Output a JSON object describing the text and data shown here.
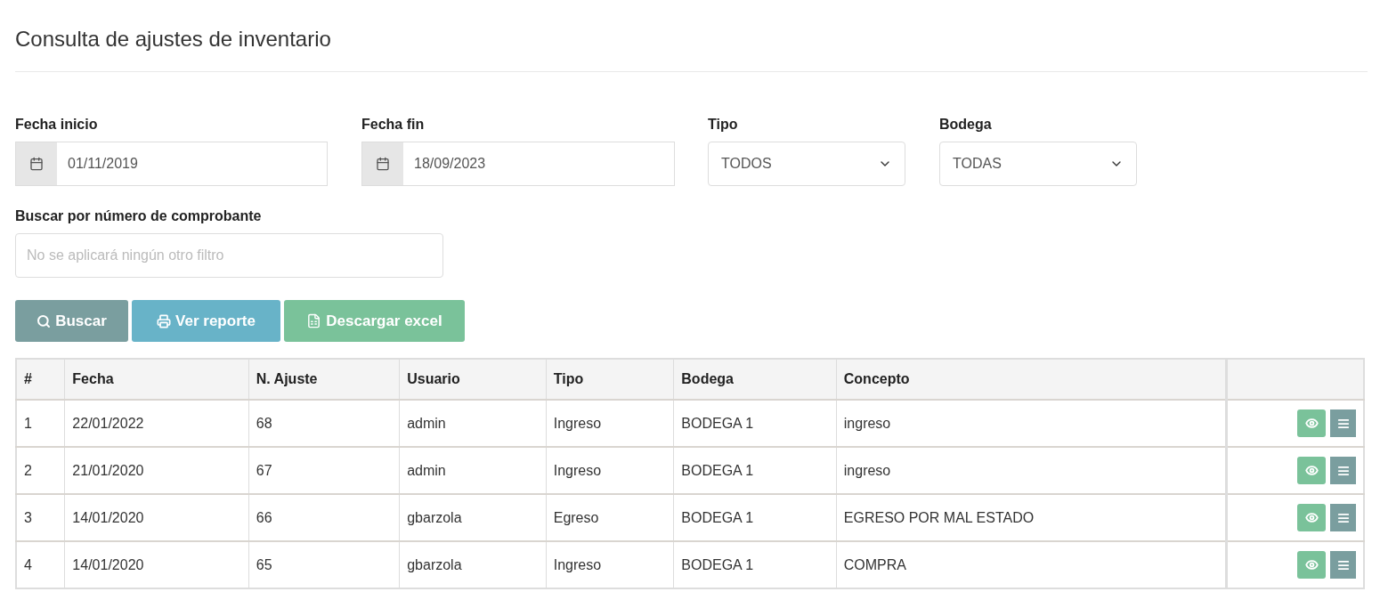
{
  "title": "Consulta de ajustes de inventario",
  "filters": {
    "fecha_inicio": {
      "label": "Fecha inicio",
      "value": "01/11/2019"
    },
    "fecha_fin": {
      "label": "Fecha fin",
      "value": "18/09/2023"
    },
    "tipo": {
      "label": "Tipo",
      "value": "TODOS"
    },
    "bodega": {
      "label": "Bodega",
      "value": "TODAS"
    },
    "comprobante": {
      "label": "Buscar por número de comprobante",
      "placeholder": "No se aplicará ningún otro filtro"
    }
  },
  "buttons": [
    {
      "kind": "search",
      "label": "Buscar"
    },
    {
      "kind": "print",
      "label": "Ver reporte"
    },
    {
      "kind": "excel",
      "label": "Descargar excel"
    }
  ],
  "table": {
    "columns": [
      "#",
      "Fecha",
      "N. Ajuste",
      "Usuario",
      "Tipo",
      "Bodega",
      "Concepto"
    ],
    "rows": [
      [
        "1",
        "22/01/2022",
        "68",
        "admin",
        "Ingreso",
        "BODEGA 1",
        "ingreso"
      ],
      [
        "2",
        "21/01/2020",
        "67",
        "admin",
        "Ingreso",
        "BODEGA 1",
        "ingreso"
      ],
      [
        "3",
        "14/01/2020",
        "66",
        "gbarzola",
        "Egreso",
        "BODEGA 1",
        "EGRESO POR MAL ESTADO"
      ],
      [
        "4",
        "14/01/2020",
        "65",
        "gbarzola",
        "Ingreso",
        "BODEGA 1",
        "COMPRA"
      ]
    ]
  }
}
